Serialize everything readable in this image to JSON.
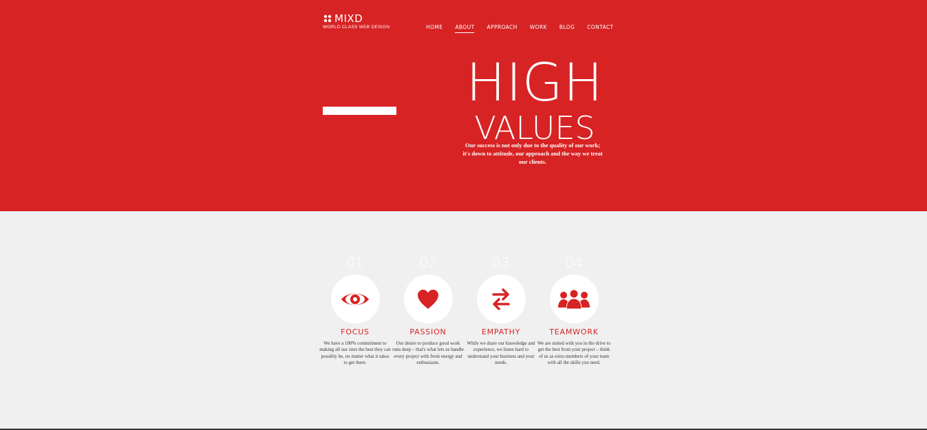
{
  "brand": {
    "name": "MIXD",
    "tagline": "WORLD CLASS WEB DESIGN",
    "accent": "#d72324"
  },
  "nav": {
    "items": [
      {
        "label": "HOME"
      },
      {
        "label": "ABOUT",
        "active": true
      },
      {
        "label": "APPROACH"
      },
      {
        "label": "WORK"
      },
      {
        "label": "BLOG"
      },
      {
        "label": "CONTACT"
      }
    ]
  },
  "hero": {
    "title_line1": "HIGH",
    "title_line2": "VALUES",
    "subtitle": "Our success is not only due to the quality of our work; it's down to attitude, our approach and the way we treat our clients."
  },
  "features": [
    {
      "number": "01",
      "title": "FOCUS",
      "icon": "eye-icon",
      "description": "We have a 100% commitment to making all our sites the best they can possibly be, no matter what it takes to get there."
    },
    {
      "number": "02",
      "title": "PASSION",
      "icon": "heart-icon",
      "description": "Our desire to produce good work runs deep – that's what lets us handle every project with fresh energy and enthusiasm."
    },
    {
      "number": "03",
      "title": "EMPATHY",
      "icon": "exchange-arrows-icon",
      "description": "While we share our knowledge and experience, we listen hard to understand your business and your needs."
    },
    {
      "number": "04",
      "title": "TEAMWORK",
      "icon": "team-icon",
      "description": "We are united with you in the drive to get the best from your project – think of us as extra members of your team with all the skills you need."
    }
  ]
}
